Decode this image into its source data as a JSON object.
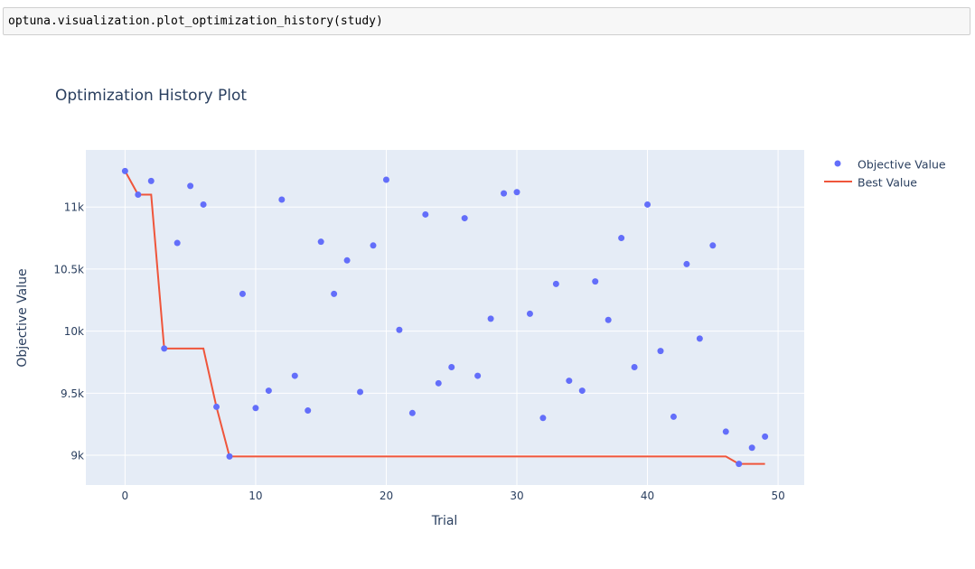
{
  "code": "optuna.visualization.plot_optimization_history(study)",
  "colors": {
    "objective": "#636efa",
    "best": "#ef553b",
    "plot_bg": "#e5ecf6",
    "grid": "#ffffff",
    "text": "#2a3f5f"
  },
  "chart_data": {
    "type": "scatter",
    "title": "Optimization History Plot",
    "xlabel": "Trial",
    "ylabel": "Objective Value",
    "xlim": [
      -3,
      52
    ],
    "ylim": [
      8760,
      11460
    ],
    "xticks": [
      0,
      10,
      20,
      30,
      40,
      50
    ],
    "xtick_labels": [
      "0",
      "10",
      "20",
      "30",
      "40",
      "50"
    ],
    "yticks": [
      9000,
      9500,
      10000,
      10500,
      11000
    ],
    "ytick_labels": [
      "9k",
      "9.5k",
      "10k",
      "10.5k",
      "11k"
    ],
    "grid": true,
    "legend_position": "right",
    "series": [
      {
        "name": "Objective Value",
        "mode": "markers",
        "x": [
          0,
          1,
          2,
          3,
          4,
          5,
          6,
          7,
          8,
          9,
          10,
          11,
          12,
          13,
          14,
          15,
          16,
          17,
          18,
          19,
          20,
          21,
          22,
          23,
          24,
          25,
          26,
          27,
          28,
          29,
          30,
          31,
          32,
          33,
          34,
          35,
          36,
          37,
          38,
          39,
          40,
          41,
          42,
          43,
          44,
          45,
          46,
          47,
          48,
          49
        ],
        "y": [
          11290,
          11100,
          11210,
          9860,
          10710,
          11170,
          11020,
          9390,
          8990,
          10300,
          9380,
          9520,
          11060,
          9640,
          9360,
          10720,
          10300,
          10570,
          9510,
          10690,
          11220,
          10010,
          9340,
          10940,
          9580,
          9710,
          10910,
          9640,
          10100,
          11110,
          11120,
          10140,
          9300,
          10380,
          9600,
          9520,
          10400,
          10090,
          10750,
          9710,
          11020,
          9840,
          9310,
          10540,
          9940,
          10690,
          9190,
          8930,
          9060,
          9150
        ]
      },
      {
        "name": "Best Value",
        "mode": "lines",
        "x": [
          0,
          1,
          2,
          3,
          4,
          5,
          6,
          7,
          8,
          9,
          10,
          11,
          12,
          13,
          14,
          15,
          16,
          17,
          18,
          19,
          20,
          21,
          22,
          23,
          24,
          25,
          26,
          27,
          28,
          29,
          30,
          31,
          32,
          33,
          34,
          35,
          36,
          37,
          38,
          39,
          40,
          41,
          42,
          43,
          44,
          45,
          46,
          47,
          48,
          49
        ],
        "y": [
          11290,
          11100,
          11100,
          9860,
          9860,
          9860,
          9860,
          9390,
          8990,
          8990,
          8990,
          8990,
          8990,
          8990,
          8990,
          8990,
          8990,
          8990,
          8990,
          8990,
          8990,
          8990,
          8990,
          8990,
          8990,
          8990,
          8990,
          8990,
          8990,
          8990,
          8990,
          8990,
          8990,
          8990,
          8990,
          8990,
          8990,
          8990,
          8990,
          8990,
          8990,
          8990,
          8990,
          8990,
          8990,
          8990,
          8990,
          8930,
          8930,
          8930
        ]
      }
    ]
  }
}
